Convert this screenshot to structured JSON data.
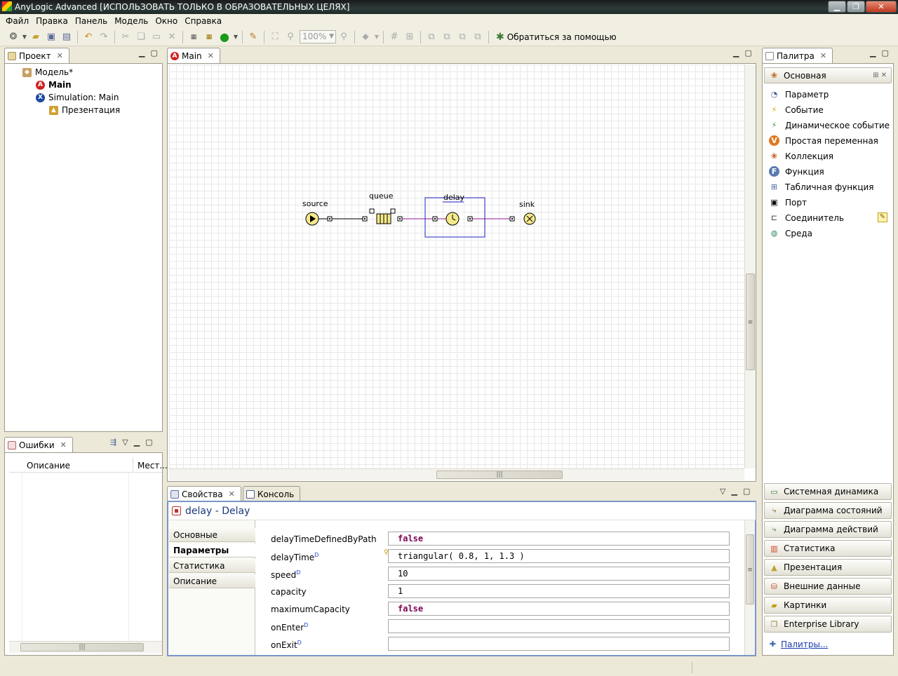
{
  "window": {
    "title": "AnyLogic Advanced [ИСПОЛЬЗОВАТЬ ТОЛЬКО В ОБРАЗОВАТЕЛЬНЫХ ЦЕЛЯХ]",
    "buttons": [
      "▁",
      "❐",
      "✕"
    ]
  },
  "menu": [
    "Файл",
    "Правка",
    "Панель",
    "Модель",
    "Окно",
    "Справка"
  ],
  "toolbar": {
    "zoom": "100%",
    "help_label": "Обратиться за помощью"
  },
  "project": {
    "tab_label": "Проект",
    "tree": [
      {
        "label": "Модель*"
      },
      {
        "label": "Main"
      },
      {
        "label": "Simulation: Main"
      },
      {
        "label": "Презентация"
      }
    ]
  },
  "errors": {
    "tab_label": "Ошибки",
    "columns": [
      "Описание",
      "Мест..."
    ]
  },
  "editor": {
    "tab_label": "Main",
    "blocks": {
      "source": "source",
      "queue": "queue",
      "delay": "delay",
      "sink": "sink"
    }
  },
  "palette": {
    "tab_label": "Палитра",
    "section_label": "Основная",
    "items": [
      {
        "label": "Параметр",
        "icon": "parameter-icon"
      },
      {
        "label": "Событие",
        "icon": "event-icon"
      },
      {
        "label": "Динамическое событие",
        "icon": "dynamic-event-icon"
      },
      {
        "label": "Простая переменная",
        "icon": "variable-icon"
      },
      {
        "label": "Коллекция",
        "icon": "collection-icon"
      },
      {
        "label": "Функция",
        "icon": "function-icon"
      },
      {
        "label": "Табличная функция",
        "icon": "table-function-icon"
      },
      {
        "label": "Порт",
        "icon": "port-icon"
      },
      {
        "label": "Соединитель",
        "icon": "connector-icon"
      },
      {
        "label": "Среда",
        "icon": "environment-icon"
      }
    ],
    "sections": [
      "Системная динамика",
      "Диаграмма состояний",
      "Диаграмма действий",
      "Статистика",
      "Презентация",
      "Внешние данные",
      "Картинки",
      "Enterprise Library"
    ],
    "more_link": "Палитры..."
  },
  "properties": {
    "tab_label": "Свойства",
    "console_tab_label": "Консоль",
    "header": "delay - Delay",
    "nav": [
      "Основные",
      "Параметры",
      "Статистика",
      "Описание"
    ],
    "rows": [
      {
        "label": "delayTimeDefinedByPath",
        "dyn": "",
        "value": "false"
      },
      {
        "label": "delayTime",
        "dyn": "D",
        "value": "triangular( 0.8, 1, 1.3 )"
      },
      {
        "label": "speed",
        "dyn": "D",
        "value": "10"
      },
      {
        "label": "capacity",
        "dyn": "",
        "value": "1"
      },
      {
        "label": "maximumCapacity",
        "dyn": "",
        "value": "false"
      },
      {
        "label": "onEnter",
        "dyn": "D",
        "value": ""
      },
      {
        "label": "onExit",
        "dyn": "D",
        "value": ""
      }
    ]
  },
  "colors": {
    "accent": "#1a3a7a",
    "block_fill": "#f5e98a",
    "selection": "#2020c0",
    "connector": "#a020a0"
  }
}
